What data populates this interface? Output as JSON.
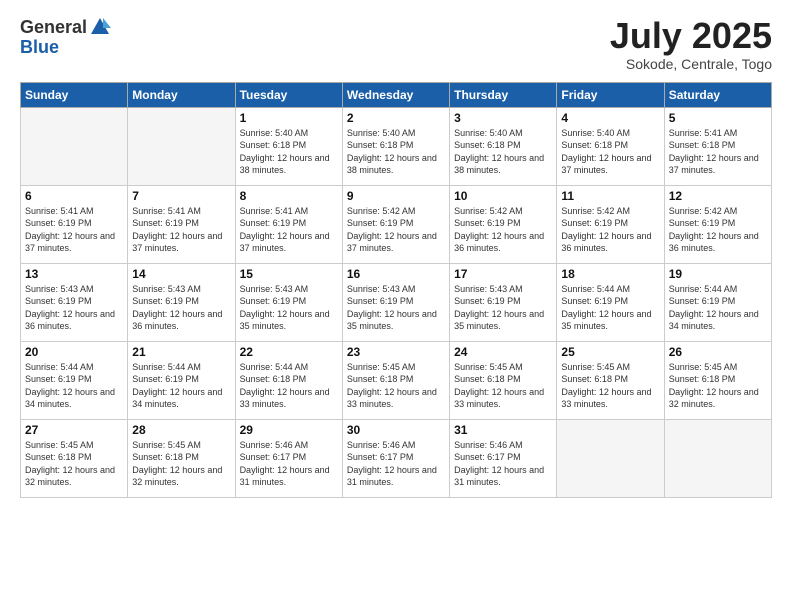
{
  "header": {
    "logo_general": "General",
    "logo_blue": "Blue",
    "month_title": "July 2025",
    "subtitle": "Sokode, Centrale, Togo"
  },
  "weekdays": [
    "Sunday",
    "Monday",
    "Tuesday",
    "Wednesday",
    "Thursday",
    "Friday",
    "Saturday"
  ],
  "weeks": [
    [
      {
        "day": "",
        "empty": true
      },
      {
        "day": "",
        "empty": true
      },
      {
        "day": "1",
        "sunrise": "5:40 AM",
        "sunset": "6:18 PM",
        "daylight": "12 hours and 38 minutes."
      },
      {
        "day": "2",
        "sunrise": "5:40 AM",
        "sunset": "6:18 PM",
        "daylight": "12 hours and 38 minutes."
      },
      {
        "day": "3",
        "sunrise": "5:40 AM",
        "sunset": "6:18 PM",
        "daylight": "12 hours and 38 minutes."
      },
      {
        "day": "4",
        "sunrise": "5:40 AM",
        "sunset": "6:18 PM",
        "daylight": "12 hours and 37 minutes."
      },
      {
        "day": "5",
        "sunrise": "5:41 AM",
        "sunset": "6:18 PM",
        "daylight": "12 hours and 37 minutes."
      }
    ],
    [
      {
        "day": "6",
        "sunrise": "5:41 AM",
        "sunset": "6:19 PM",
        "daylight": "12 hours and 37 minutes."
      },
      {
        "day": "7",
        "sunrise": "5:41 AM",
        "sunset": "6:19 PM",
        "daylight": "12 hours and 37 minutes."
      },
      {
        "day": "8",
        "sunrise": "5:41 AM",
        "sunset": "6:19 PM",
        "daylight": "12 hours and 37 minutes."
      },
      {
        "day": "9",
        "sunrise": "5:42 AM",
        "sunset": "6:19 PM",
        "daylight": "12 hours and 37 minutes."
      },
      {
        "day": "10",
        "sunrise": "5:42 AM",
        "sunset": "6:19 PM",
        "daylight": "12 hours and 36 minutes."
      },
      {
        "day": "11",
        "sunrise": "5:42 AM",
        "sunset": "6:19 PM",
        "daylight": "12 hours and 36 minutes."
      },
      {
        "day": "12",
        "sunrise": "5:42 AM",
        "sunset": "6:19 PM",
        "daylight": "12 hours and 36 minutes."
      }
    ],
    [
      {
        "day": "13",
        "sunrise": "5:43 AM",
        "sunset": "6:19 PM",
        "daylight": "12 hours and 36 minutes."
      },
      {
        "day": "14",
        "sunrise": "5:43 AM",
        "sunset": "6:19 PM",
        "daylight": "12 hours and 36 minutes."
      },
      {
        "day": "15",
        "sunrise": "5:43 AM",
        "sunset": "6:19 PM",
        "daylight": "12 hours and 35 minutes."
      },
      {
        "day": "16",
        "sunrise": "5:43 AM",
        "sunset": "6:19 PM",
        "daylight": "12 hours and 35 minutes."
      },
      {
        "day": "17",
        "sunrise": "5:43 AM",
        "sunset": "6:19 PM",
        "daylight": "12 hours and 35 minutes."
      },
      {
        "day": "18",
        "sunrise": "5:44 AM",
        "sunset": "6:19 PM",
        "daylight": "12 hours and 35 minutes."
      },
      {
        "day": "19",
        "sunrise": "5:44 AM",
        "sunset": "6:19 PM",
        "daylight": "12 hours and 34 minutes."
      }
    ],
    [
      {
        "day": "20",
        "sunrise": "5:44 AM",
        "sunset": "6:19 PM",
        "daylight": "12 hours and 34 minutes."
      },
      {
        "day": "21",
        "sunrise": "5:44 AM",
        "sunset": "6:19 PM",
        "daylight": "12 hours and 34 minutes."
      },
      {
        "day": "22",
        "sunrise": "5:44 AM",
        "sunset": "6:18 PM",
        "daylight": "12 hours and 33 minutes."
      },
      {
        "day": "23",
        "sunrise": "5:45 AM",
        "sunset": "6:18 PM",
        "daylight": "12 hours and 33 minutes."
      },
      {
        "day": "24",
        "sunrise": "5:45 AM",
        "sunset": "6:18 PM",
        "daylight": "12 hours and 33 minutes."
      },
      {
        "day": "25",
        "sunrise": "5:45 AM",
        "sunset": "6:18 PM",
        "daylight": "12 hours and 33 minutes."
      },
      {
        "day": "26",
        "sunrise": "5:45 AM",
        "sunset": "6:18 PM",
        "daylight": "12 hours and 32 minutes."
      }
    ],
    [
      {
        "day": "27",
        "sunrise": "5:45 AM",
        "sunset": "6:18 PM",
        "daylight": "12 hours and 32 minutes."
      },
      {
        "day": "28",
        "sunrise": "5:45 AM",
        "sunset": "6:18 PM",
        "daylight": "12 hours and 32 minutes."
      },
      {
        "day": "29",
        "sunrise": "5:46 AM",
        "sunset": "6:17 PM",
        "daylight": "12 hours and 31 minutes."
      },
      {
        "day": "30",
        "sunrise": "5:46 AM",
        "sunset": "6:17 PM",
        "daylight": "12 hours and 31 minutes."
      },
      {
        "day": "31",
        "sunrise": "5:46 AM",
        "sunset": "6:17 PM",
        "daylight": "12 hours and 31 minutes."
      },
      {
        "day": "",
        "empty": true
      },
      {
        "day": "",
        "empty": true
      }
    ]
  ]
}
